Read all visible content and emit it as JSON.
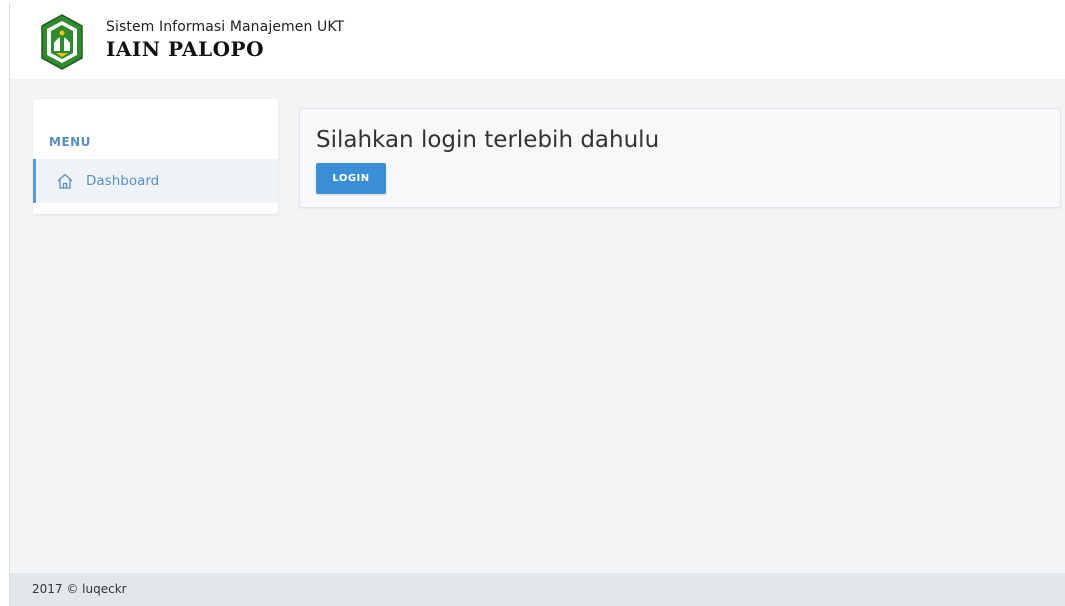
{
  "header": {
    "subtitle": "Sistem Informasi Manajemen UKT",
    "title": "IAIN PALOPO",
    "logo_icon": "iain-palopo-logo"
  },
  "sidebar": {
    "menu_heading": "MENU",
    "items": [
      {
        "label": "Dashboard",
        "icon": "home-icon",
        "active": true
      }
    ]
  },
  "main": {
    "message": "Silahkan login terlebih dahulu",
    "login_label": "LOGIN"
  },
  "footer": {
    "text": "2017 © luqeckr"
  },
  "colors": {
    "accent": "#3b8fd6",
    "menu_text": "#5b8fc4",
    "logo_green": "#2e8b2e",
    "background": "#f3f4f6"
  }
}
